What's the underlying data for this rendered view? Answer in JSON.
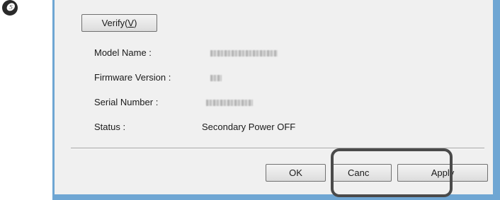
{
  "step_badge": "❺",
  "verify_button": {
    "label": "Verify",
    "mnemonic": "V"
  },
  "info_rows": [
    {
      "label": "Model Name :",
      "value": ""
    },
    {
      "label": "Firmware Version :",
      "value": ""
    },
    {
      "label": "Serial Number :",
      "value": ""
    },
    {
      "label": "Status :",
      "value": "Secondary Power OFF"
    }
  ],
  "buttons": {
    "ok": "OK",
    "cancel": "Canc",
    "apply": "Apply"
  },
  "colors": {
    "frame": "#6fa6d3",
    "highlight": "#4a4a4a"
  }
}
